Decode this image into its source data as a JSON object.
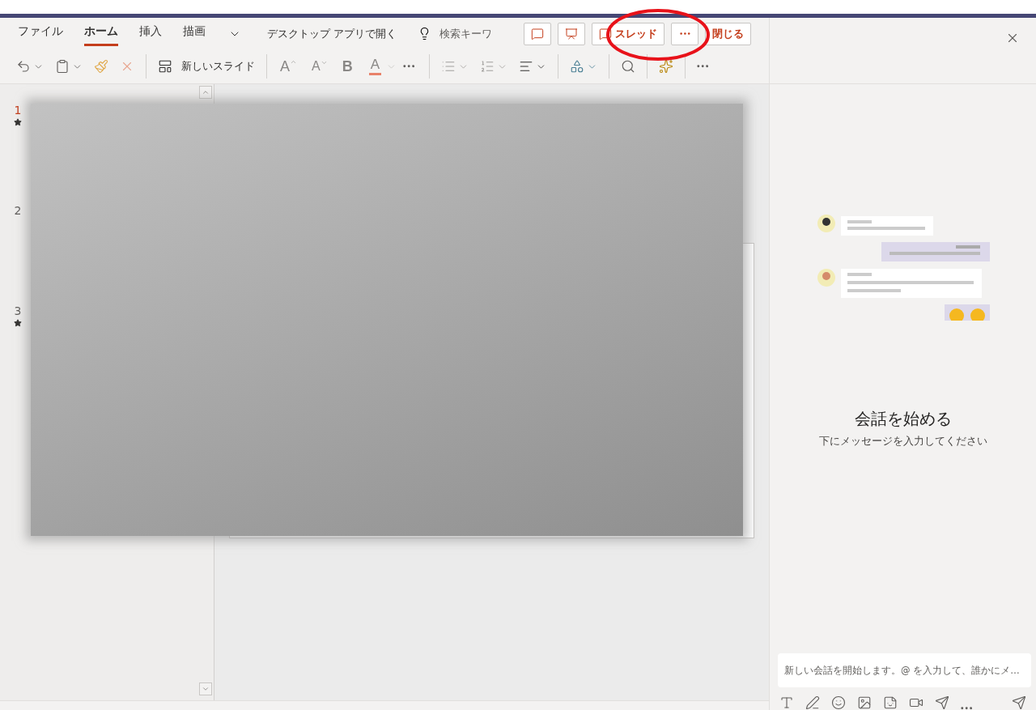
{
  "ribbon": {
    "tabs": [
      {
        "label": "ファイル",
        "selected": false
      },
      {
        "label": "ホーム",
        "selected": true
      },
      {
        "label": "挿入",
        "selected": false
      },
      {
        "label": "描画",
        "selected": false
      }
    ],
    "open_in_desktop": "デスクトップ アプリで開く",
    "search": {
      "placeholder": "検索キーワ"
    },
    "actions": [
      {
        "kind": "comment"
      },
      {
        "kind": "present"
      },
      {
        "kind": "thread",
        "label": "スレッド"
      },
      {
        "kind": "more"
      },
      {
        "kind": "close",
        "label": "閉じる"
      }
    ]
  },
  "toolbar": {
    "new_slide": "新しいスライド",
    "grow_font": "A",
    "shrink_font": "A",
    "bold": "B",
    "font_color": "A"
  },
  "slides": [
    {
      "number": "1",
      "selected": true,
      "animated": true
    },
    {
      "number": "2",
      "selected": false,
      "animated": false
    },
    {
      "number": "3",
      "selected": false,
      "animated": true
    }
  ],
  "chat": {
    "heading": "会話を始める",
    "subtitle": "下にメッセージを入力してください",
    "compose": {
      "placeholder": "新しい会話を開始します。@ を入力して、誰かにメ…"
    }
  }
}
